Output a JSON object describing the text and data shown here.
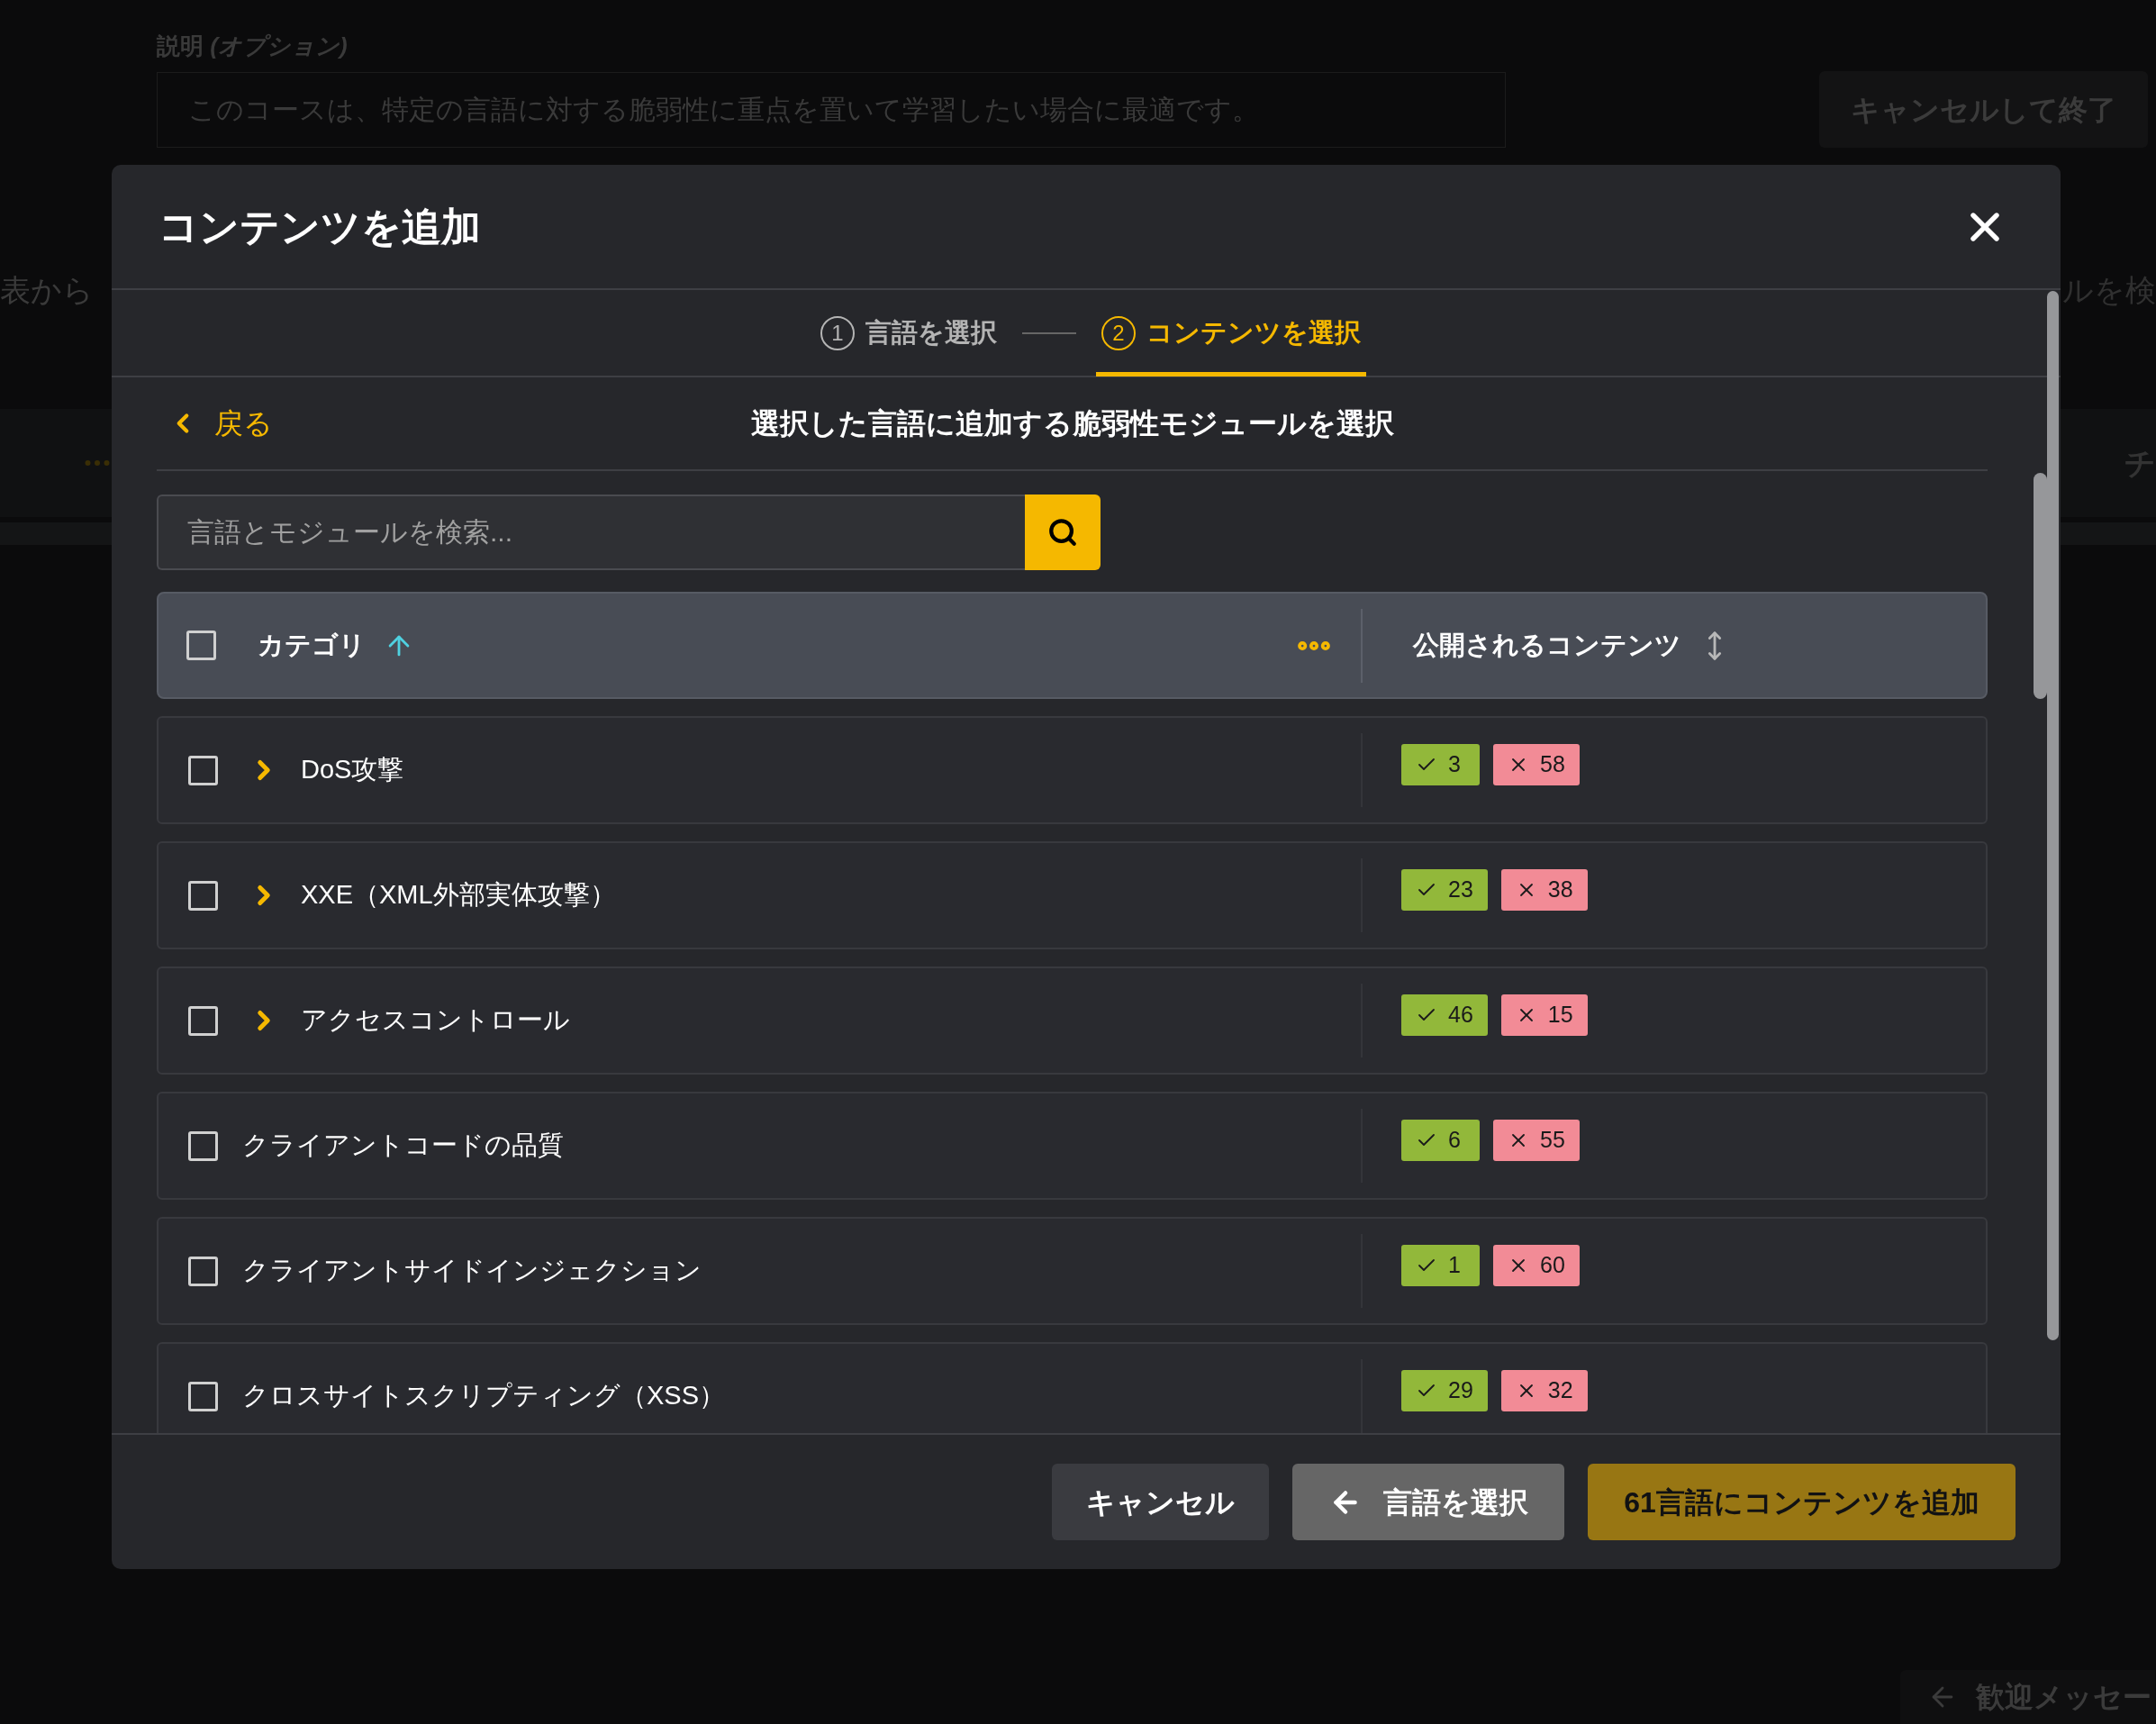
{
  "background": {
    "description_label": "説明 *(オプション)*",
    "description_placeholder": "このコースは、特定の言語に対する脆弱性に重点を置いて学習したい場合に最適です。",
    "exit_button": "キャンセルして終了",
    "left_fragment": "表から",
    "right_fragment": "ルを検",
    "right_column_fragment": "チ",
    "welcome_button": "歓迎メッセー"
  },
  "modal": {
    "title": "コンテンツを追加",
    "steps": [
      {
        "number": "1",
        "label": "言語を選択",
        "selected": false
      },
      {
        "number": "2",
        "label": "コンテンツを選択",
        "selected": true
      }
    ],
    "back_link": "戻る",
    "subtitle": "選択した言語に追加する脆弱性モジュールを選択",
    "search": {
      "placeholder": "言語とモジュールを検索..."
    },
    "table": {
      "select_all_checked": false,
      "columns": [
        {
          "label": "カテゴリ",
          "sorted": true
        },
        {
          "label": "公開されるコンテンツ",
          "sorted": false
        }
      ],
      "rows": [
        {
          "name": "DoS攻撃",
          "checked": false,
          "expandable": true,
          "published": "3",
          "unpublished": "58"
        },
        {
          "name": "XXE（XML外部実体攻撃）",
          "checked": false,
          "expandable": true,
          "published": "23",
          "unpublished": "38"
        },
        {
          "name": "アクセスコントロール",
          "checked": false,
          "expandable": true,
          "published": "46",
          "unpublished": "15"
        },
        {
          "name": "クライアントコードの品質",
          "checked": false,
          "expandable": false,
          "published": "6",
          "unpublished": "55"
        },
        {
          "name": "クライアントサイドインジェクション",
          "checked": false,
          "expandable": false,
          "published": "1",
          "unpublished": "60"
        },
        {
          "name": "クロスサイトスクリプティング（XSS）",
          "checked": false,
          "expandable": false,
          "published": "29",
          "unpublished": "32"
        }
      ]
    },
    "buttons": [
      {
        "kind": "secondary",
        "label": "キャンセル",
        "disabled": false
      },
      {
        "kind": "back",
        "label": "言語を選択",
        "disabled": false
      },
      {
        "kind": "primary",
        "label": "61言語にコンテンツを追加",
        "disabled": true
      }
    ]
  }
}
